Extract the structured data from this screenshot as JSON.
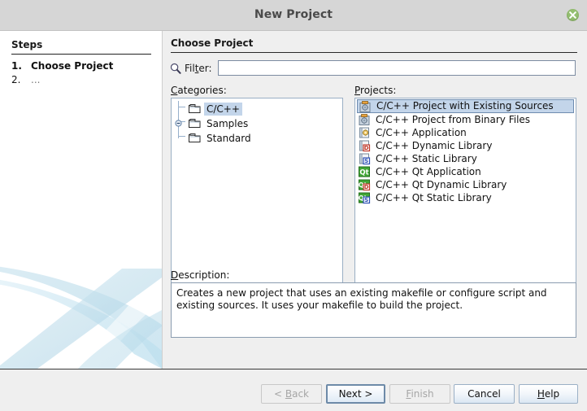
{
  "window": {
    "title": "New Project",
    "close_icon": "close-circle-icon"
  },
  "sidebar": {
    "heading": "Steps",
    "steps": [
      {
        "num": "1.",
        "label": "Choose Project"
      },
      {
        "num": "2.",
        "label": "..."
      }
    ]
  },
  "main": {
    "title": "Choose Project",
    "filter": {
      "icon": "search-icon",
      "label_pre": "Fil",
      "label_mnemonic": "t",
      "label_post": "er:",
      "value": "",
      "placeholder": ""
    },
    "categories": {
      "label_mnemonic": "C",
      "label_rest": "ategories:",
      "items": [
        {
          "label": "C/C++",
          "icon": "folder-icon",
          "selected": true,
          "expandable": false
        },
        {
          "label": "Samples",
          "icon": "folder-icon",
          "selected": false,
          "expandable": true
        },
        {
          "label": "Standard",
          "icon": "folder-icon",
          "selected": false,
          "expandable": false
        }
      ]
    },
    "projects": {
      "label_mnemonic": "P",
      "label_rest": "rojects:",
      "items": [
        {
          "label": "C/C++ Project with Existing Sources",
          "icon": "project-existing-sources-icon",
          "selected": true
        },
        {
          "label": "C/C++ Project from Binary Files",
          "icon": "project-binary-files-icon",
          "selected": false
        },
        {
          "label": "C/C++ Application",
          "icon": "application-icon",
          "selected": false
        },
        {
          "label": "C/C++ Dynamic Library",
          "icon": "dynamic-library-icon",
          "selected": false
        },
        {
          "label": "C/C++ Static Library",
          "icon": "static-library-icon",
          "selected": false
        },
        {
          "label": "C/C++ Qt Application",
          "icon": "qt-application-icon",
          "selected": false
        },
        {
          "label": "C/C++ Qt Dynamic Library",
          "icon": "qt-dynamic-library-icon",
          "selected": false
        },
        {
          "label": "C/C++ Qt Static Library",
          "icon": "qt-static-library-icon",
          "selected": false
        }
      ]
    },
    "description": {
      "label_mnemonic": "D",
      "label_rest": "escription:",
      "text": "Creates a new project that uses an existing makefile or configure script and existing sources. It uses your makefile to build the project."
    }
  },
  "footer": {
    "buttons": [
      {
        "name": "back",
        "pre": "< ",
        "mnemonic": "B",
        "post": "ack",
        "state": "disabled"
      },
      {
        "name": "next",
        "pre": "",
        "mnemonic": "",
        "post": "Next >",
        "state": "default"
      },
      {
        "name": "finish",
        "pre": "",
        "mnemonic": "F",
        "post": "inish",
        "state": "disabled"
      },
      {
        "name": "cancel",
        "pre": "",
        "mnemonic": "",
        "post": "Cancel",
        "state": "normal"
      },
      {
        "name": "help",
        "pre": "",
        "mnemonic": "H",
        "post": "elp",
        "state": "normal"
      }
    ]
  },
  "colors": {
    "selection": "#c3d5ea",
    "titlebar": "#d6d6d6",
    "panel": "#efefef",
    "close_button": "#94bf70",
    "accent_border": "#9aafc4"
  }
}
